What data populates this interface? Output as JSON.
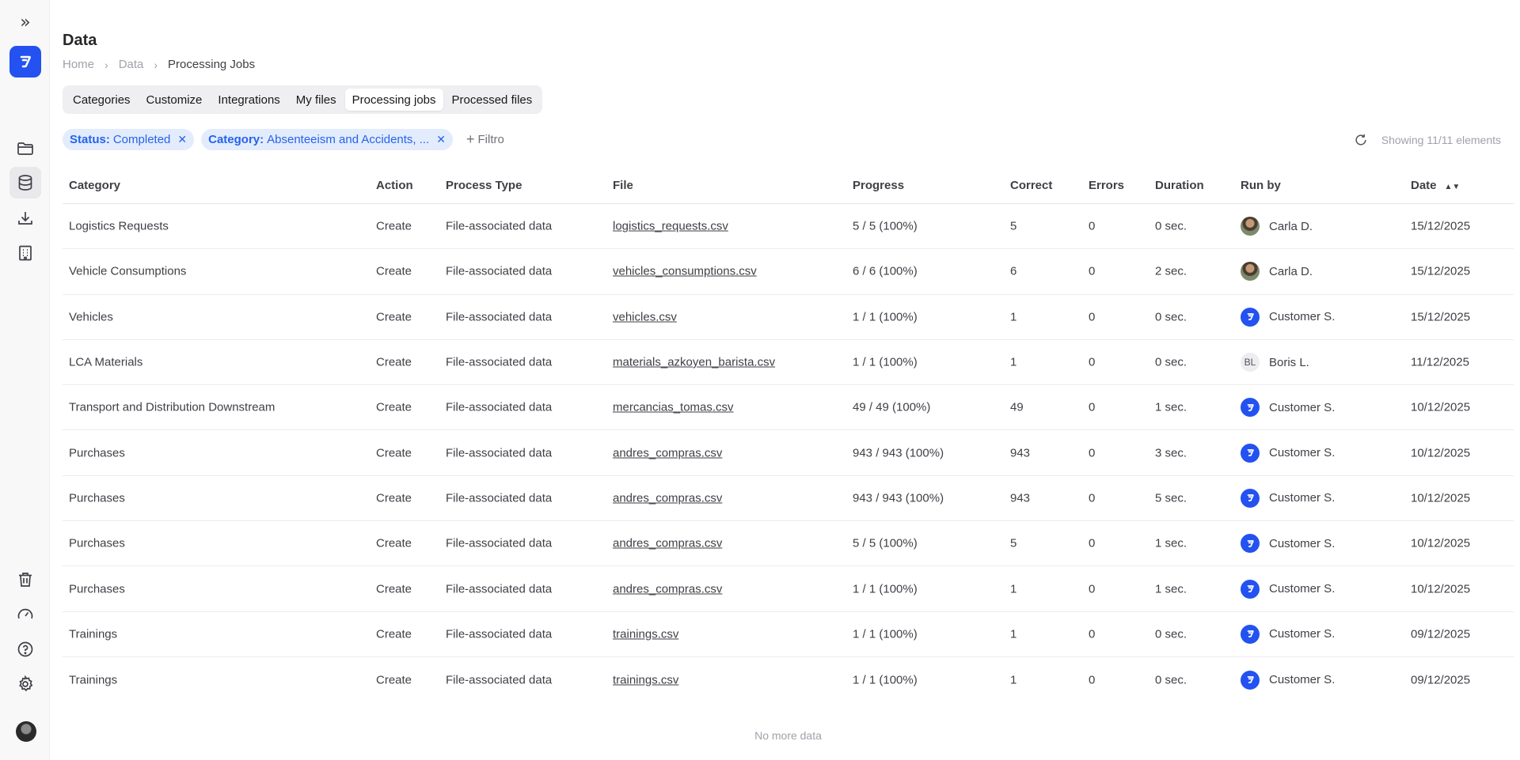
{
  "sidebar": {
    "expand_icon": "double-chevron-right-icon",
    "items": [
      {
        "name": "folder-icon",
        "active": false
      },
      {
        "name": "database-icon",
        "active": true
      },
      {
        "name": "download-icon",
        "active": false
      },
      {
        "name": "building-icon",
        "active": false
      }
    ],
    "bottom_items": [
      "trash-icon",
      "gauge-icon",
      "help-icon",
      "settings-icon"
    ],
    "brand_color": "#2352f0"
  },
  "header": {
    "title": "Data",
    "breadcrumb": [
      "Home",
      "Data",
      "Processing Jobs"
    ]
  },
  "tabs": [
    {
      "label": "Categories",
      "active": false
    },
    {
      "label": "Customize",
      "active": false
    },
    {
      "label": "Integrations",
      "active": false
    },
    {
      "label": "My files",
      "active": false
    },
    {
      "label": "Processing jobs",
      "active": true
    },
    {
      "label": "Processed files",
      "active": false
    }
  ],
  "filters": {
    "chips": [
      {
        "key": "Status:",
        "value": "Completed"
      },
      {
        "key": "Category:",
        "value": "Absenteeism and Accidents, ..."
      }
    ],
    "add_label": "Filtro"
  },
  "toolbar": {
    "showing": "Showing 11/11 elements"
  },
  "table": {
    "columns": [
      "Category",
      "Action",
      "Process Type",
      "File",
      "Progress",
      "Correct",
      "Errors",
      "Duration",
      "Run by",
      "Date"
    ],
    "rows": [
      {
        "category": "Logistics Requests",
        "action": "Create",
        "type": "File-associated data",
        "file": "logistics_requests.csv",
        "progress": "5 / 5 (100%)",
        "correct": "5",
        "errors": "0",
        "duration": "0 sec.",
        "run_by": "Carla D.",
        "avatar": "photo",
        "date": "15/12/2025"
      },
      {
        "category": "Vehicle Consumptions",
        "action": "Create",
        "type": "File-associated data",
        "file": "vehicles_consumptions.csv",
        "progress": "6 / 6 (100%)",
        "correct": "6",
        "errors": "0",
        "duration": "2 sec.",
        "run_by": "Carla D.",
        "avatar": "photo",
        "date": "15/12/2025"
      },
      {
        "category": "Vehicles",
        "action": "Create",
        "type": "File-associated data",
        "file": "vehicles.csv",
        "progress": "1 / 1 (100%)",
        "correct": "1",
        "errors": "0",
        "duration": "0 sec.",
        "run_by": "Customer S.",
        "avatar": "brand",
        "date": "15/12/2025"
      },
      {
        "category": "LCA Materials",
        "action": "Create",
        "type": "File-associated data",
        "file": "materials_azkoyen_barista.csv",
        "progress": "1 / 1 (100%)",
        "correct": "1",
        "errors": "0",
        "duration": "0 sec.",
        "run_by": "Boris L.",
        "avatar": "BL",
        "date": "11/12/2025"
      },
      {
        "category": "Transport and Distribution Downstream",
        "action": "Create",
        "type": "File-associated data",
        "file": "mercancias_tomas.csv",
        "progress": "49 / 49 (100%)",
        "correct": "49",
        "errors": "0",
        "duration": "1 sec.",
        "run_by": "Customer S.",
        "avatar": "brand",
        "date": "10/12/2025"
      },
      {
        "category": "Purchases",
        "action": "Create",
        "type": "File-associated data",
        "file": "andres_compras.csv",
        "progress": "943 / 943 (100%)",
        "correct": "943",
        "errors": "0",
        "duration": "3 sec.",
        "run_by": "Customer S.",
        "avatar": "brand",
        "date": "10/12/2025"
      },
      {
        "category": "Purchases",
        "action": "Create",
        "type": "File-associated data",
        "file": "andres_compras.csv",
        "progress": "943 / 943 (100%)",
        "correct": "943",
        "errors": "0",
        "duration": "5 sec.",
        "run_by": "Customer S.",
        "avatar": "brand",
        "date": "10/12/2025"
      },
      {
        "category": "Purchases",
        "action": "Create",
        "type": "File-associated data",
        "file": "andres_compras.csv",
        "progress": "5 / 5 (100%)",
        "correct": "5",
        "errors": "0",
        "duration": "1 sec.",
        "run_by": "Customer S.",
        "avatar": "brand",
        "date": "10/12/2025"
      },
      {
        "category": "Purchases",
        "action": "Create",
        "type": "File-associated data",
        "file": "andres_compras.csv",
        "progress": "1 / 1 (100%)",
        "correct": "1",
        "errors": "0",
        "duration": "1 sec.",
        "run_by": "Customer S.",
        "avatar": "brand",
        "date": "10/12/2025"
      },
      {
        "category": "Trainings",
        "action": "Create",
        "type": "File-associated data",
        "file": "trainings.csv",
        "progress": "1 / 1 (100%)",
        "correct": "1",
        "errors": "0",
        "duration": "0 sec.",
        "run_by": "Customer S.",
        "avatar": "brand",
        "date": "09/12/2025"
      },
      {
        "category": "Trainings",
        "action": "Create",
        "type": "File-associated data",
        "file": "trainings.csv",
        "progress": "1 / 1 (100%)",
        "correct": "1",
        "errors": "0",
        "duration": "0 sec.",
        "run_by": "Customer S.",
        "avatar": "brand",
        "date": "09/12/2025"
      }
    ],
    "footer": "No more data"
  }
}
